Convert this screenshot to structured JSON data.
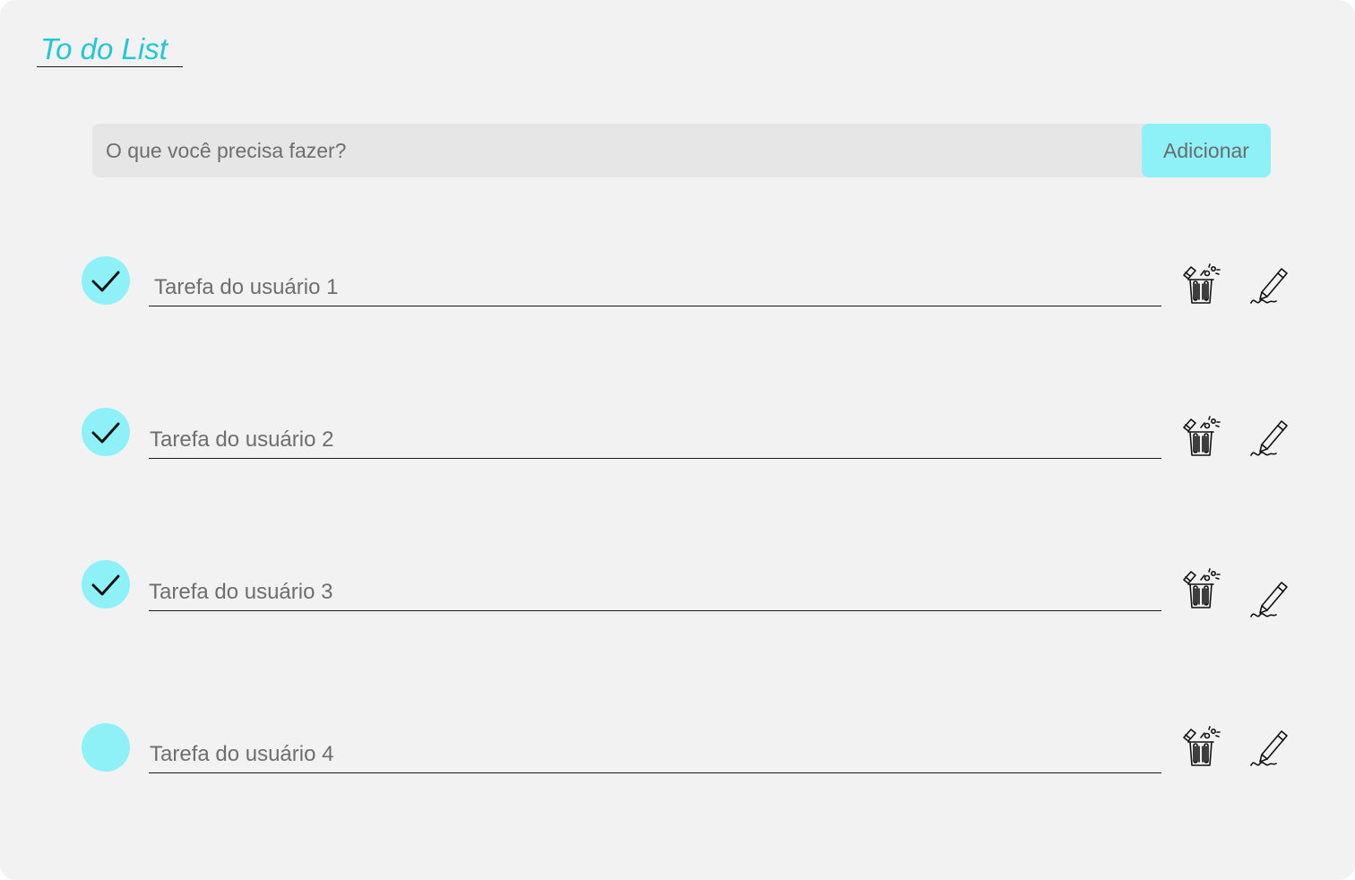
{
  "app": {
    "title": "To do List"
  },
  "add_bar": {
    "placeholder": "O que você precisa fazer?",
    "button_label": "Adicionar"
  },
  "colors": {
    "accent": "#8ef1f7",
    "title": "#22c7d6",
    "background": "#f2f2f2",
    "input_background": "#e6e6e6"
  },
  "tasks": [
    {
      "label": "Tarefa do usuário 1",
      "done": true,
      "delete_icon": "trash-icon",
      "edit_icon": "pencil-icon"
    },
    {
      "label": "Tarefa do usuário 2",
      "done": true,
      "delete_icon": "trash-icon",
      "edit_icon": "pencil-icon"
    },
    {
      "label": "Tarefa do usuário 3",
      "done": true,
      "delete_icon": "trash-icon",
      "edit_icon": "pencil-icon"
    },
    {
      "label": "Tarefa do usuário 4",
      "done": false,
      "delete_icon": "trash-icon",
      "edit_icon": "pencil-icon"
    }
  ]
}
